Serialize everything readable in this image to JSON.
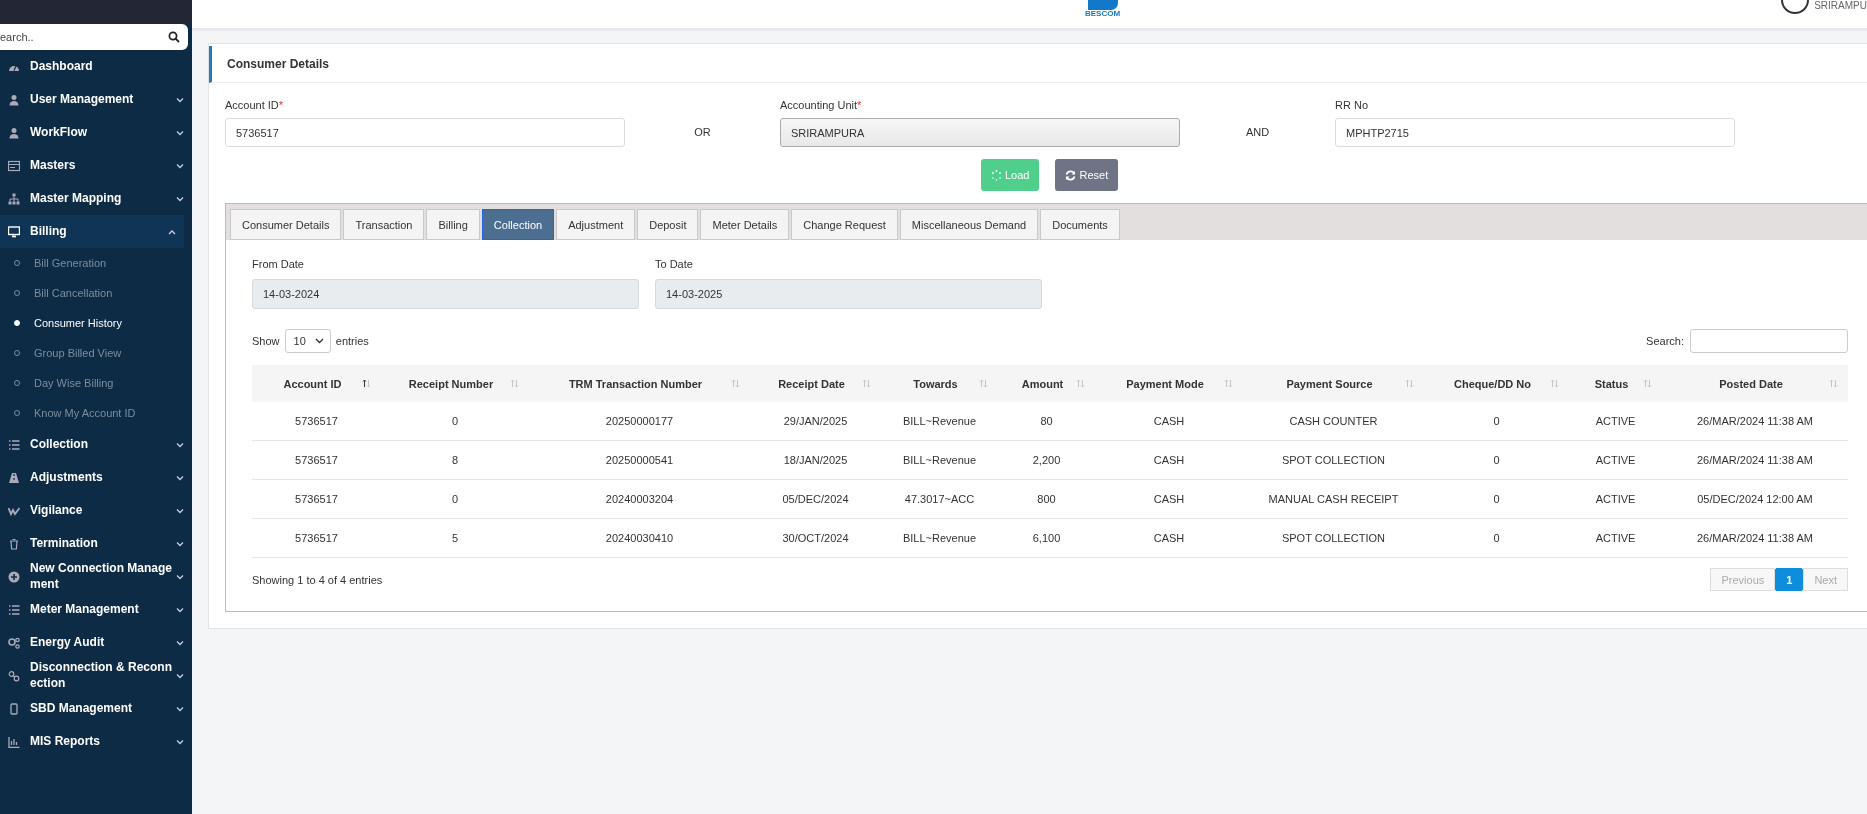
{
  "sidebar": {
    "search": {
      "placeholder": "earch.."
    },
    "items": [
      {
        "label": "Dashboard"
      },
      {
        "label": "User Management",
        "expanded": false
      },
      {
        "label": "WorkFlow",
        "expanded": false
      },
      {
        "label": "Masters",
        "expanded": false
      },
      {
        "label": "Master Mapping",
        "expanded": false
      },
      {
        "label": "Billing",
        "expanded": true,
        "children": [
          {
            "label": "Bill Generation",
            "selected": false
          },
          {
            "label": "Bill Cancellation",
            "selected": false
          },
          {
            "label": "Consumer History",
            "selected": true
          },
          {
            "label": "Group Billed View",
            "selected": false
          },
          {
            "label": "Day Wise Billing",
            "selected": false
          },
          {
            "label": "Know My Account ID",
            "selected": false
          }
        ]
      },
      {
        "label": "Collection",
        "expanded": false
      },
      {
        "label": "Adjustments",
        "expanded": false
      },
      {
        "label": "Vigilance",
        "expanded": false
      },
      {
        "label": "Termination",
        "expanded": false
      },
      {
        "label": "New Connection Management",
        "expanded": false
      },
      {
        "label": "Meter Management",
        "expanded": false
      },
      {
        "label": "Energy Audit",
        "expanded": false
      },
      {
        "label": "Disconnection & Reconnection",
        "expanded": false
      },
      {
        "label": "SBD Management",
        "expanded": false
      },
      {
        "label": "MIS Reports",
        "expanded": false
      }
    ]
  },
  "topbar": {
    "logo_text": "BESCOM",
    "user_unit": "SRIRAMPU"
  },
  "card": {
    "title": "Consumer Details",
    "fields": [
      {
        "label": "Account ID",
        "required_mark": "*",
        "value": "5736517",
        "kind": "text"
      },
      {
        "label": "Accounting Unit",
        "required_mark": "*",
        "value": "SRIRAMPURA",
        "kind": "select"
      },
      {
        "label": "RR No",
        "value": "MPHTP2715",
        "kind": "text"
      }
    ],
    "joiners": [
      "OR",
      "AND"
    ],
    "buttons": [
      {
        "label": "Load",
        "kind": "load"
      },
      {
        "label": "Reset",
        "kind": "reset"
      }
    ],
    "tabs": [
      {
        "label": "Consumer Details",
        "selected": false
      },
      {
        "label": "Transaction",
        "selected": false
      },
      {
        "label": "Billing",
        "selected": false
      },
      {
        "label": "Collection",
        "selected": true
      },
      {
        "label": "Adjustment",
        "selected": false
      },
      {
        "label": "Deposit",
        "selected": false
      },
      {
        "label": "Meter Details",
        "selected": false
      },
      {
        "label": "Change Request",
        "selected": false
      },
      {
        "label": "Miscellaneous Demand",
        "selected": false
      },
      {
        "label": "Documents",
        "selected": false
      }
    ],
    "dates": [
      {
        "label": "From Date",
        "value": "14-03-2024"
      },
      {
        "label": "To Date",
        "value": "14-03-2025"
      }
    ],
    "length": {
      "show": "Show",
      "value": "10",
      "entries": "entries"
    },
    "search_label": "Search:",
    "table": {
      "columns": [
        {
          "label": "Account ID",
          "sorted": true
        },
        {
          "label": "Receipt Number",
          "sorted": false
        },
        {
          "label": "TRM Transaction Number",
          "sorted": false
        },
        {
          "label": "Receipt Date",
          "sorted": false
        },
        {
          "label": "Towards",
          "sorted": false
        },
        {
          "label": "Amount",
          "sorted": false
        },
        {
          "label": "Payment Mode",
          "sorted": false
        },
        {
          "label": "Payment Source",
          "sorted": false
        },
        {
          "label": "Cheque/DD No",
          "sorted": false
        },
        {
          "label": "Status",
          "sorted": false
        },
        {
          "label": "Posted Date",
          "sorted": false
        }
      ],
      "rows": [
        [
          "5736517",
          "0",
          "20250000177",
          "29/JAN/2025",
          "BILL~Revenue",
          "80",
          "CASH",
          "CASH COUNTER",
          "0",
          "ACTIVE",
          "26/MAR/2024 11:38 AM"
        ],
        [
          "5736517",
          "8",
          "20250000541",
          "18/JAN/2025",
          "BILL~Revenue",
          "2,200",
          "CASH",
          "SPOT COLLECTION",
          "0",
          "ACTIVE",
          "26/MAR/2024 11:38 AM"
        ],
        [
          "5736517",
          "0",
          "20240003204",
          "05/DEC/2024",
          "47.3017~ACC",
          "800",
          "CASH",
          "MANUAL CASH RECEIPT",
          "0",
          "ACTIVE",
          "05/DEC/2024 12:00 AM"
        ],
        [
          "5736517",
          "5",
          "20240030410",
          "30/OCT/2024",
          "BILL~Revenue",
          "6,100",
          "CASH",
          "SPOT COLLECTION",
          "0",
          "ACTIVE",
          "26/MAR/2024 11:38 AM"
        ]
      ]
    },
    "info": "Showing 1 to 4 of 4 entries",
    "pagination": [
      {
        "label": "Previous",
        "disabled": true,
        "selected": false
      },
      {
        "label": "1",
        "disabled": false,
        "selected": true
      },
      {
        "label": "Next",
        "disabled": true,
        "selected": false
      }
    ]
  }
}
